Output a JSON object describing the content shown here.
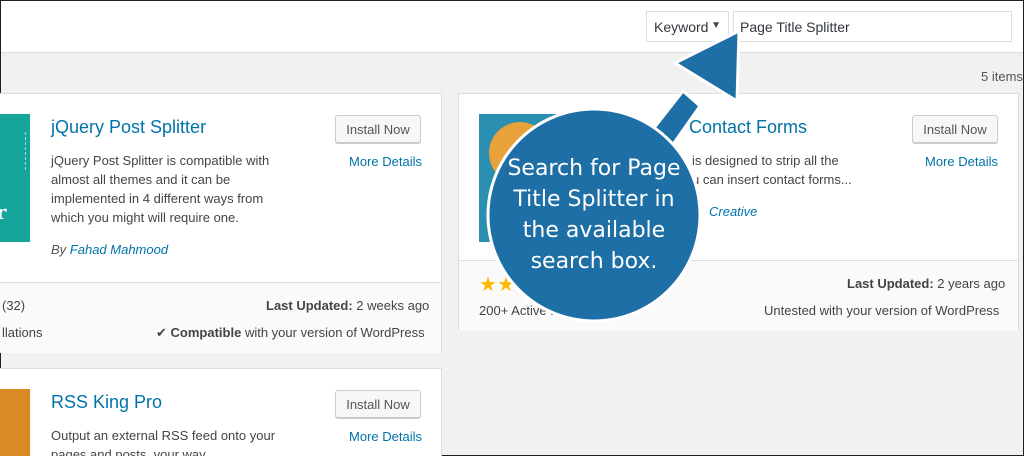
{
  "search": {
    "type_label": "Keyword",
    "dropdown_arrow": "▼",
    "query": "Page Title Splitter"
  },
  "results": {
    "count": "5 items"
  },
  "plugins": [
    {
      "title": "jQuery Post Splitter",
      "install_label": "Install Now",
      "details_label": "More Details",
      "description_lines": [
        "jQuery Post Splitter is compatible with",
        "almost all themes and it can be",
        "implemented in 4 different ways from",
        "which you might will require one."
      ],
      "author_prefix": "By",
      "author": "Fahad Mahmood",
      "rating_count": "(32)",
      "installs_fragment": "llations",
      "last_updated_label": "Last Updated:",
      "last_updated": "2 weeks ago",
      "compat_check": "✔",
      "compat_label": "Compatible",
      "compat_rest": "with your version of WordPress"
    },
    {
      "title": "Contact Forms",
      "install_label": "Install Now",
      "details_label": "More Details",
      "description_lines": [
        "is designed to strip all the",
        "u can insert contact forms..."
      ],
      "author": "Creative",
      "installs_fragment": "200+ Active I",
      "last_updated_label": "Last Updated:",
      "last_updated": "2 years ago",
      "compat_text": "Untested with your version of WordPress"
    },
    {
      "title": "RSS King Pro",
      "install_label": "Install Now",
      "details_label": "More Details",
      "description_lines": [
        "Output an external RSS feed onto your",
        "pages and posts, your way"
      ]
    }
  ],
  "callout": {
    "lines": [
      "Search for Page",
      "Title Splitter in",
      "the available",
      "search box."
    ]
  },
  "colors": {
    "wp_link": "#0073aa",
    "callout_blue": "#1e6fa5",
    "star": "#ffb900"
  },
  "icons": {
    "star": "★",
    "check": "✔"
  }
}
